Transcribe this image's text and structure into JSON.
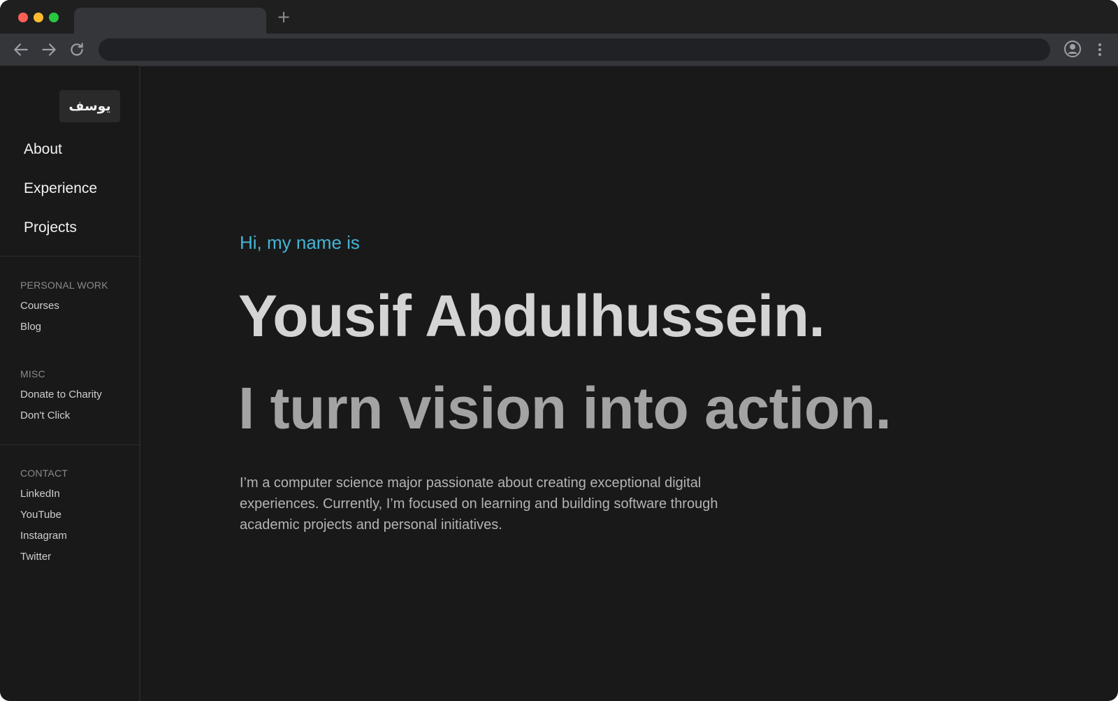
{
  "browser": {
    "new_tab_symbol": "+",
    "icons": [
      "back-arrow-icon",
      "forward-arrow-icon",
      "reload-icon",
      "profile-icon",
      "more-options-icon"
    ],
    "traffic_light_colors": [
      "#fe5f57",
      "#febc2e",
      "#28c840"
    ]
  },
  "sidebar": {
    "logo": "يوسف",
    "nav": [
      {
        "label": "About"
      },
      {
        "label": "Experience"
      },
      {
        "label": "Projects"
      }
    ],
    "sections": [
      {
        "title": "PERSONAL WORK",
        "links": [
          "Courses",
          "Blog"
        ]
      },
      {
        "title": "MISC",
        "links": [
          "Donate to Charity",
          "Don't Click"
        ]
      },
      {
        "title": "CONTACT",
        "links": [
          "LinkedIn",
          "YouTube",
          "Instagram",
          "Twitter"
        ]
      }
    ]
  },
  "hero": {
    "greeting": "Hi, my name is",
    "name": "Yousif Abdulhussein.",
    "tagline": "I turn vision into action.",
    "bio": "I’m a computer science major passionate about creating exceptional digital experiences. Currently, I’m focused on learning and building software through academic projects and personal initiatives."
  },
  "colors": {
    "accent": "#45b4d6",
    "background": "#191919",
    "name_text": "#d4d4d4",
    "tagline_text": "#a3a3a3"
  }
}
